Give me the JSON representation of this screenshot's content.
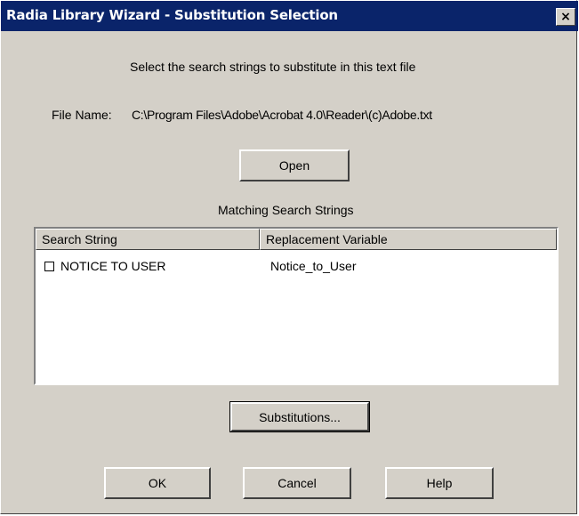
{
  "window": {
    "title": "Radia Library Wizard - Substitution Selection",
    "close_glyph": "×"
  },
  "instructions": "Select the search strings to substitute in this text file",
  "file": {
    "label": "File Name:",
    "path": "C:\\Program Files\\Adobe\\Acrobat 4.0\\Reader\\(c)Adobe.txt"
  },
  "open_button": "Open",
  "matches_label": "Matching Search Strings",
  "list": {
    "columns": [
      "Search String",
      "Replacement Variable"
    ],
    "rows": [
      {
        "checked": false,
        "search": "NOTICE TO USER",
        "replacement": "Notice_to_User"
      }
    ]
  },
  "substitutions_button": "Substitutions...",
  "footer": {
    "ok": "OK",
    "cancel": "Cancel",
    "help": "Help"
  },
  "colors": {
    "face": "#d4d0c8",
    "titlebar": "#0a246a",
    "title_text": "#ffffff"
  }
}
